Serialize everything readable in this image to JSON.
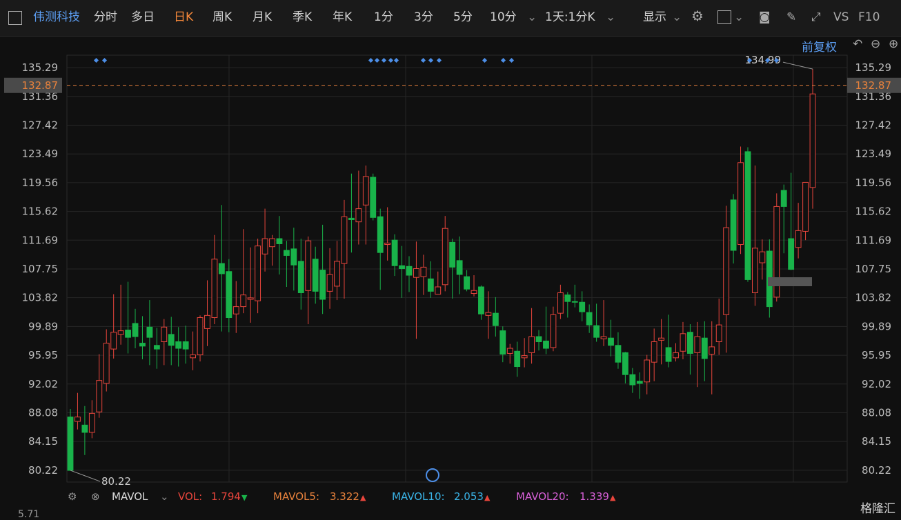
{
  "toolbar": {
    "stock_name": "伟测科技",
    "periods": [
      "分时",
      "多日",
      "日K",
      "周K",
      "月K",
      "季K",
      "年K",
      "1分",
      "3分",
      "5分",
      "10分"
    ],
    "active_period": "日K",
    "range_select": "1天:1分K",
    "display_label": "显示",
    "vs_label": "VS",
    "f10_label": "F10"
  },
  "fuquan_label": "前复权",
  "chart_data": {
    "type": "candlestick",
    "y_ticks": [
      "135.29",
      "131.36",
      "127.42",
      "123.49",
      "119.56",
      "115.62",
      "111.69",
      "107.75",
      "103.82",
      "99.89",
      "95.95",
      "92.02",
      "88.08",
      "84.15",
      "80.22"
    ],
    "ylim": [
      78.6,
      137.0
    ],
    "current_price": "132.87",
    "high_label": "134.99",
    "low_label": "80.22",
    "colors": {
      "up": "#e8453c",
      "down": "#19b34a",
      "current": "#e8823c",
      "grid": "#262626"
    },
    "candles": [
      [
        87.5,
        80.2,
        88.6,
        80.6
      ],
      [
        86.9,
        87.5,
        90.8,
        85.8
      ],
      [
        86.4,
        85.4,
        89.0,
        82.3
      ],
      [
        85.4,
        88.0,
        89.8,
        84.6
      ],
      [
        88.2,
        92.5,
        96.1,
        87.4
      ],
      [
        92.1,
        97.6,
        99.5,
        91.0
      ],
      [
        96.8,
        99.1,
        104.3,
        95.5
      ],
      [
        98.8,
        99.3,
        105.6,
        97.4
      ],
      [
        99.4,
        98.4,
        106.0,
        96.2
      ],
      [
        100.3,
        98.5,
        102.3,
        96.9
      ],
      [
        97.6,
        97.2,
        101.3,
        95.4
      ],
      [
        99.8,
        98.4,
        103.5,
        94.6
      ],
      [
        97.3,
        96.8,
        99.7,
        94.1
      ],
      [
        97.8,
        99.8,
        100.9,
        94.6
      ],
      [
        98.8,
        97.3,
        101.2,
        94.6
      ],
      [
        97.8,
        96.9,
        99.8,
        94.4
      ],
      [
        97.8,
        96.8,
        100.0,
        94.8
      ],
      [
        95.6,
        96.0,
        99.2,
        93.9
      ],
      [
        96.0,
        101.1,
        101.4,
        95.1
      ],
      [
        99.6,
        101.4,
        106.2,
        97.2
      ],
      [
        101.1,
        109.1,
        112.4,
        100.2
      ],
      [
        108.5,
        107.1,
        116.5,
        99.2
      ],
      [
        107.4,
        101.1,
        109.1,
        99.1
      ],
      [
        101.6,
        102.6,
        106.1,
        99.0
      ],
      [
        102.6,
        104.2,
        113.2,
        101.7
      ],
      [
        103.6,
        103.8,
        110.7,
        100.4
      ],
      [
        103.4,
        110.9,
        111.9,
        101.7
      ],
      [
        109.8,
        111.9,
        116.0,
        107.4
      ],
      [
        110.8,
        111.9,
        112.4,
        108.2
      ],
      [
        111.9,
        111.2,
        115.0,
        107.0
      ],
      [
        110.3,
        109.6,
        111.6,
        105.3
      ],
      [
        110.5,
        108.3,
        113.4,
        104.8
      ],
      [
        108.8,
        104.5,
        111.9,
        102.2
      ],
      [
        104.8,
        111.6,
        112.2,
        100.2
      ],
      [
        109.1,
        104.7,
        110.8,
        103.0
      ],
      [
        107.6,
        103.6,
        113.8,
        101.6
      ],
      [
        104.7,
        107.0,
        110.6,
        102.3
      ],
      [
        105.4,
        108.8,
        111.6,
        103.5
      ],
      [
        108.5,
        114.9,
        117.2,
        103.7
      ],
      [
        114.7,
        114.5,
        120.8,
        110.0
      ],
      [
        114.2,
        116.0,
        121.2,
        111.1
      ],
      [
        116.5,
        120.4,
        121.9,
        111.1
      ],
      [
        120.3,
        114.8,
        120.8,
        114.4
      ],
      [
        114.9,
        110.0,
        116.0,
        104.9
      ],
      [
        111.1,
        111.3,
        116.2,
        108.9
      ],
      [
        111.7,
        108.2,
        112.5,
        106.8
      ],
      [
        108.2,
        107.8,
        110.9,
        103.8
      ],
      [
        108.1,
        106.9,
        109.5,
        104.6
      ],
      [
        106.6,
        107.8,
        111.5,
        98.2
      ],
      [
        106.7,
        108.0,
        109.7,
        104.2
      ],
      [
        106.4,
        104.7,
        108.8,
        103.8
      ],
      [
        104.3,
        105.3,
        107.4,
        104.6
      ],
      [
        105.6,
        113.3,
        115.0,
        104.7
      ],
      [
        111.4,
        108.0,
        111.9,
        103.7
      ],
      [
        108.9,
        107.0,
        112.2,
        104.3
      ],
      [
        106.7,
        105.0,
        107.6,
        104.7
      ],
      [
        104.4,
        104.8,
        106.9,
        104.0
      ],
      [
        105.3,
        101.6,
        105.5,
        100.8
      ],
      [
        101.4,
        101.8,
        104.7,
        98.2
      ],
      [
        101.7,
        100.0,
        103.9,
        98.5
      ],
      [
        99.3,
        96.1,
        99.9,
        95.0
      ],
      [
        96.2,
        96.9,
        97.5,
        94.8
      ],
      [
        96.5,
        94.4,
        97.8,
        93.0
      ],
      [
        95.6,
        95.9,
        98.3,
        94.3
      ],
      [
        96.3,
        98.5,
        102.4,
        94.8
      ],
      [
        98.5,
        97.8,
        99.4,
        96.6
      ],
      [
        97.9,
        96.9,
        102.6,
        96.1
      ],
      [
        97.0,
        101.5,
        102.6,
        96.5
      ],
      [
        101.7,
        104.5,
        105.6,
        100.9
      ],
      [
        104.2,
        103.3,
        104.6,
        101.1
      ],
      [
        103.3,
        103.2,
        105.6,
        102.5
      ],
      [
        103.2,
        101.9,
        104.7,
        100.6
      ],
      [
        101.8,
        100.1,
        102.9,
        99.0
      ],
      [
        100.0,
        98.4,
        103.0,
        97.8
      ],
      [
        98.2,
        98.5,
        103.5,
        97.2
      ],
      [
        98.3,
        97.3,
        100.8,
        95.8
      ],
      [
        97.3,
        95.0,
        99.1,
        94.1
      ],
      [
        96.3,
        93.3,
        96.4,
        92.1
      ],
      [
        93.3,
        91.9,
        94.2,
        90.8
      ],
      [
        92.4,
        92.1,
        93.6,
        90.0
      ],
      [
        92.3,
        95.3,
        96.0,
        90.6
      ],
      [
        95.0,
        97.8,
        99.6,
        92.4
      ],
      [
        98.0,
        98.3,
        100.9,
        94.7
      ],
      [
        97.0,
        95.1,
        101.5,
        94.3
      ],
      [
        95.6,
        96.3,
        97.6,
        95.1
      ],
      [
        96.5,
        98.9,
        100.5,
        95.4
      ],
      [
        99.1,
        96.2,
        100.2,
        93.3
      ],
      [
        96.3,
        98.5,
        100.5,
        91.6
      ],
      [
        98.3,
        95.5,
        100.6,
        92.4
      ],
      [
        96.1,
        97.1,
        100.6,
        90.6
      ],
      [
        97.8,
        100.1,
        103.7,
        96.0
      ],
      [
        101.5,
        113.4,
        116.4,
        96.3
      ],
      [
        117.2,
        110.3,
        118.0,
        108.5
      ],
      [
        111.1,
        122.3,
        124.5,
        109.8
      ],
      [
        123.8,
        106.3,
        124.4,
        106.0
      ],
      [
        104.5,
        110.6,
        121.9,
        102.7
      ],
      [
        108.6,
        110.1,
        111.8,
        106.3
      ],
      [
        110.2,
        102.6,
        111.8,
        101.1
      ],
      [
        103.9,
        116.3,
        118.1,
        103.3
      ],
      [
        118.5,
        116.3,
        119.3,
        109.9
      ],
      [
        111.9,
        107.7,
        120.9,
        107.6
      ],
      [
        110.7,
        113.0,
        116.8,
        109.2
      ],
      [
        112.9,
        119.6,
        119.6,
        111.7
      ],
      [
        118.9,
        131.7,
        135.1,
        116.0
      ]
    ]
  },
  "volume_bar": {
    "indicator": "MAVOL",
    "items": [
      {
        "label": "VOL:",
        "value": "1.794",
        "arrow": "▼",
        "color": "#e8453c"
      },
      {
        "label": "MAVOL5:",
        "value": "3.322",
        "arrow": "▲",
        "color": "#e8823c"
      },
      {
        "label": "MAVOL10:",
        "value": "2.053",
        "arrow": "▲",
        "color": "#3ab4e8"
      },
      {
        "label": "MAVOL20:",
        "value": "1.339",
        "arrow": "▲",
        "color": "#d860d8"
      }
    ],
    "axis_value": "5.71"
  },
  "watermark": "格隆汇"
}
